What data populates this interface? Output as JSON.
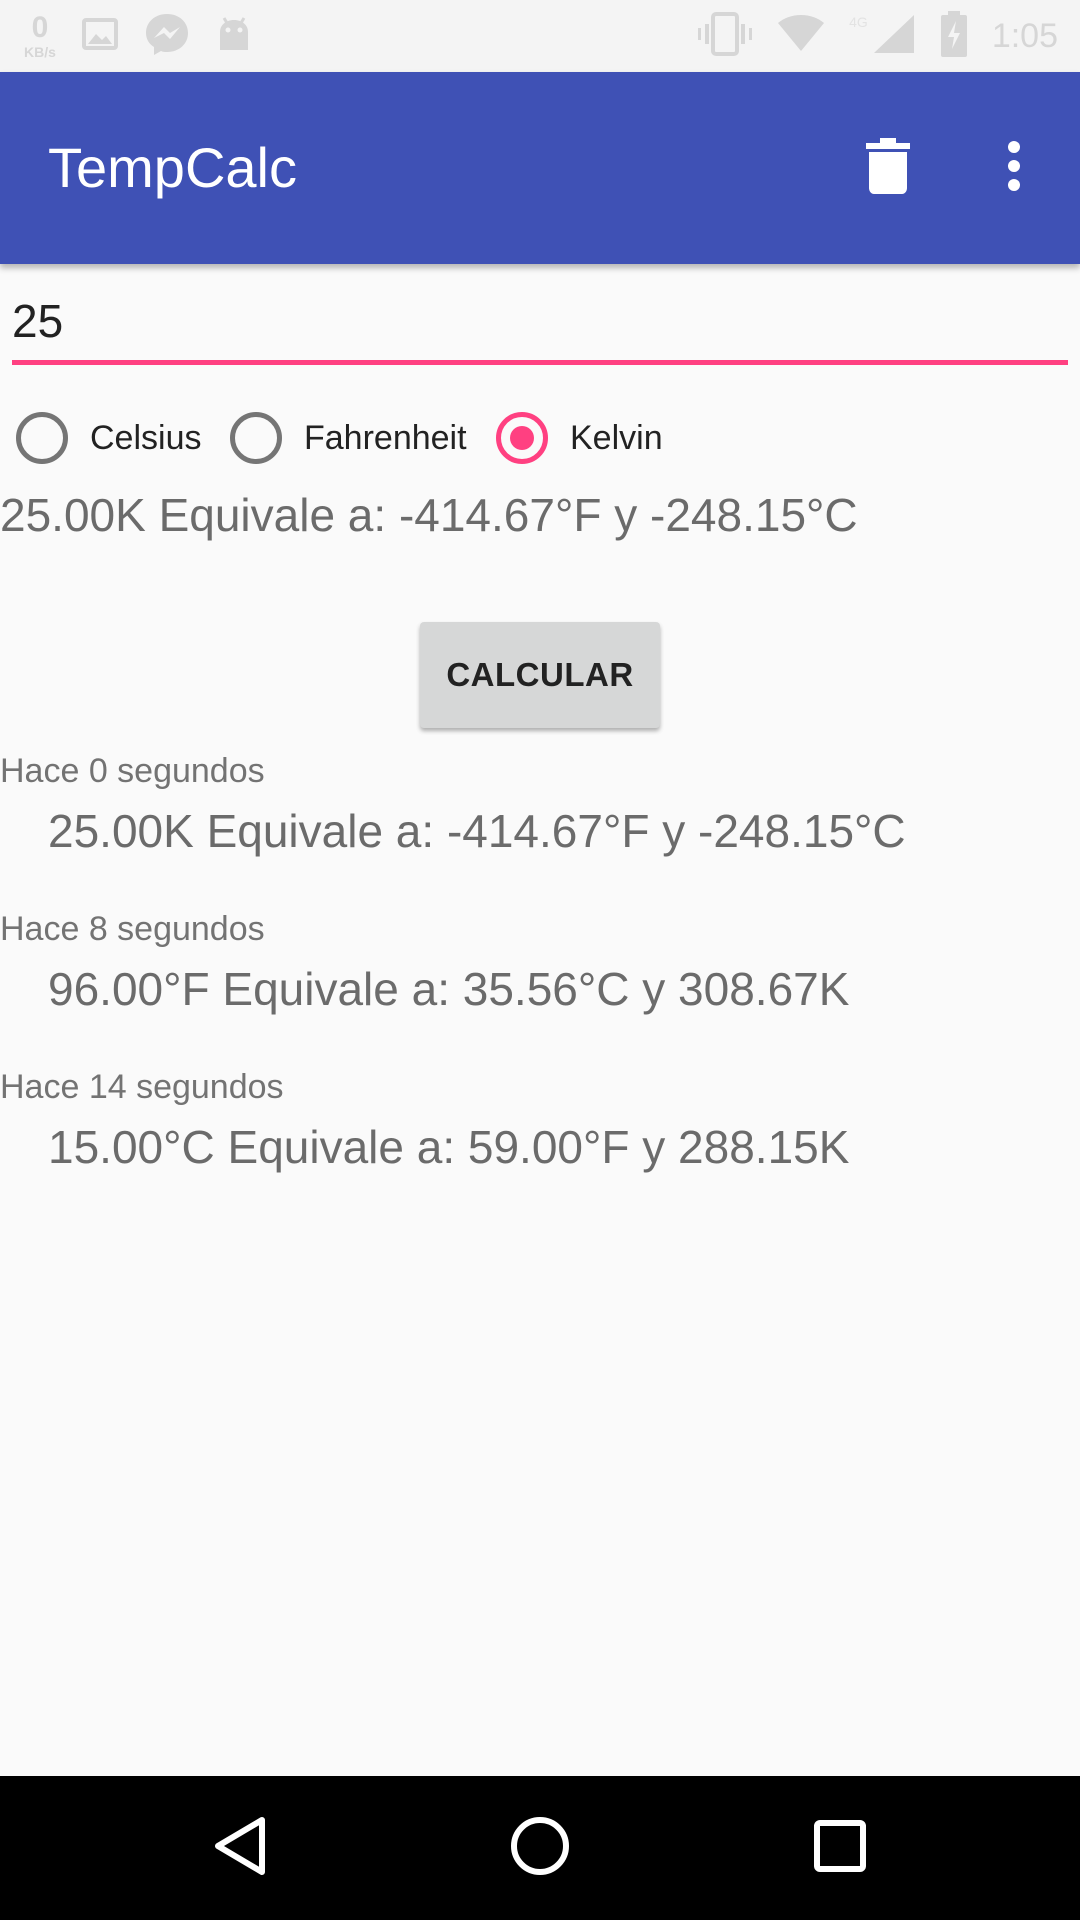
{
  "status_bar": {
    "kbs_value": "0",
    "kbs_unit": "KB/s",
    "network": "4G",
    "time": "1:05",
    "icons": [
      "gallery-icon",
      "messenger-icon",
      "android-icon",
      "vibrate-icon",
      "wifi-icon",
      "signal-icon",
      "battery-icon"
    ]
  },
  "app_bar": {
    "title": "TempCalc",
    "background": "#3f51b5",
    "actions": [
      "trash-icon",
      "more-vert-icon"
    ]
  },
  "input": {
    "value": "25",
    "accent": "#ff4081"
  },
  "units": [
    {
      "label": "Celsius",
      "checked": false
    },
    {
      "label": "Fahrenheit",
      "checked": false
    },
    {
      "label": "Kelvin",
      "checked": true
    }
  ],
  "result": "25.00K Equivale a: -414.67°F y -248.15°C",
  "calculate_label": "CALCULAR",
  "history": [
    {
      "time": "Hace 0 segundos",
      "text": "25.00K Equivale a: -414.67°F y -248.15°C"
    },
    {
      "time": "Hace 8 segundos",
      "text": "96.00°F Equivale a: 35.56°C y 308.67K"
    },
    {
      "time": "Hace 14 segundos",
      "text": "15.00°C Equivale a: 59.00°F y 288.15K"
    }
  ],
  "nav_bar": [
    "back-icon",
    "home-icon",
    "recents-icon"
  ]
}
